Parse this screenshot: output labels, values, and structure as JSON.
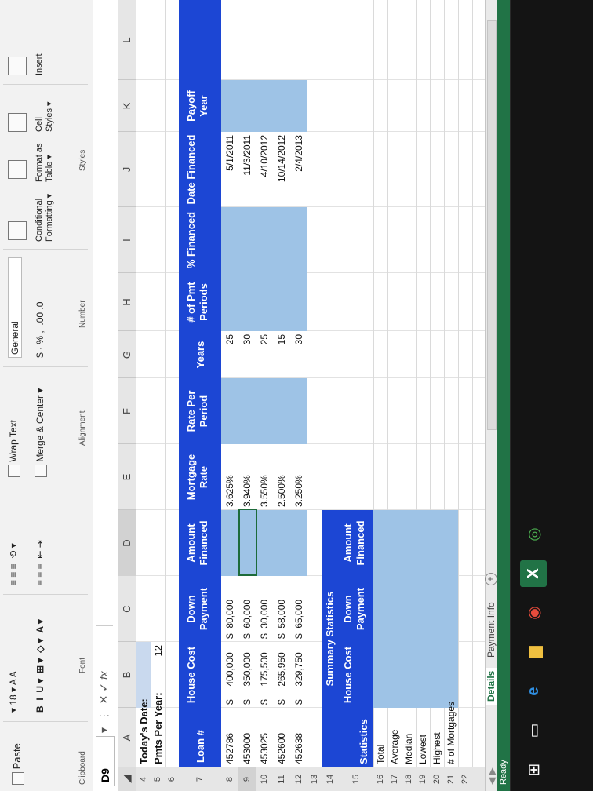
{
  "ribbon": {
    "paste": "Paste",
    "clipboard": "Clipboard",
    "font_size": "18",
    "font_group": "Font",
    "alignment_group": "Alignment",
    "wrap_text": "Wrap Text",
    "merge_center": "Merge & Center",
    "number_format": "General",
    "number_group": "Number",
    "conditional": "Conditional",
    "formatting": "Formatting",
    "format_as": "Format as",
    "table": "Table",
    "cell": "Cell",
    "styles_btn": "Styles",
    "styles_group": "Styles",
    "insert": "Insert",
    "currency": "$ · % ,",
    "decimals": ".00 .0"
  },
  "formula_bar": {
    "name_box": "D9",
    "fx": "fx"
  },
  "columns": [
    "A",
    "B",
    "C",
    "D",
    "E",
    "F",
    "G",
    "H",
    "I",
    "J",
    "K",
    "L"
  ],
  "rows": [
    "4",
    "5",
    "6",
    "7",
    "8",
    "9",
    "10",
    "11",
    "12",
    "13",
    "14",
    "15",
    "16",
    "17",
    "18",
    "19",
    "20",
    "21",
    "22"
  ],
  "sheet": {
    "todays_date_label": "Today's Date:",
    "pmts_per_year_label": "Pmts Per Year:",
    "pmts_per_year_value": "12",
    "headers": [
      "Loan #",
      "House Cost",
      "Down Payment",
      "Amount Financed",
      "Mortgage Rate",
      "Rate Per Period",
      "Years",
      "# of Pmt Periods",
      "% Financed",
      "Date Financed",
      "Payoff Year"
    ],
    "loans": [
      {
        "loan": "452786",
        "cost": "$     400,000",
        "down": "$  80,000",
        "rate": "3.625%",
        "years": "25",
        "date": "5/1/2011"
      },
      {
        "loan": "453000",
        "cost": "$     350,000",
        "down": "$  60,000",
        "rate": "3.940%",
        "years": "30",
        "date": "11/3/2011"
      },
      {
        "loan": "453025",
        "cost": "$     175,500",
        "down": "$  30,000",
        "rate": "3.550%",
        "years": "25",
        "date": "4/10/2012"
      },
      {
        "loan": "452600",
        "cost": "$     265,950",
        "down": "$  58,000",
        "rate": "2.500%",
        "years": "15",
        "date": "10/14/2012"
      },
      {
        "loan": "452638",
        "cost": "$     329,750",
        "down": "$  65,000",
        "rate": "3.250%",
        "years": "30",
        "date": "2/4/2013"
      }
    ],
    "summary_title": "Summary Statistics",
    "summary_headers": [
      "Statistics",
      "House Cost",
      "Down Payment",
      "Amount Financed"
    ],
    "stat_labels": [
      "Total",
      "Average",
      "Median",
      "Lowest",
      "Highest",
      "# of Mortgages"
    ]
  },
  "tabs": {
    "details": "Details",
    "payment_info": "Payment Info",
    "add": "+"
  },
  "status": "Ready"
}
